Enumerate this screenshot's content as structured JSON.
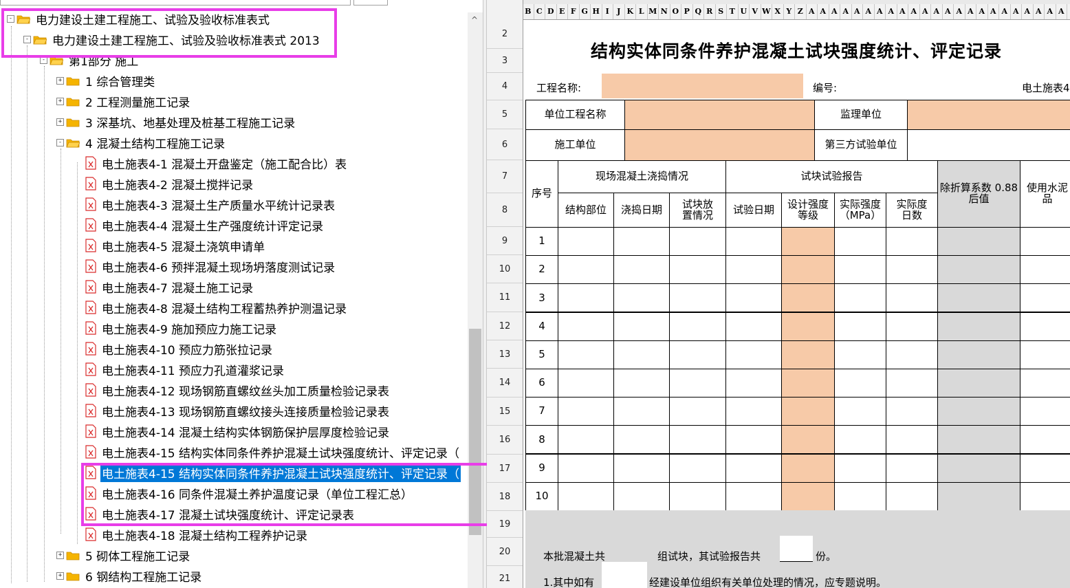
{
  "tree": {
    "root": "电力建设土建工程施工、试验及验收标准表式",
    "version": "电力建设土建工程施工、试验及验收标准表式 2013",
    "part": "第1部分 施工",
    "categories": [
      "1 综合管理类",
      "2 工程测量施工记录",
      "3 深基坑、地基处理及桩基工程施工记录",
      "4 混凝土结构工程施工记录"
    ],
    "items": [
      "电土施表4-1 混凝土开盘鉴定（施工配合比）表",
      "电土施表4-2 混凝土搅拌记录",
      "电土施表4-3 混凝土生产质量水平统计记录表",
      "电土施表4-4 混凝土生产强度统计评定记录",
      "电土施表4-5 混凝土浇筑申请单",
      "电土施表4-6 预拌混凝土现场坍落度测试记录",
      "电土施表4-7 混凝土施工记录",
      "电土施表4-8 混凝土结构工程蓄热养护测温记录",
      "电土施表4-9 施加预应力施工记录",
      "电土施表4-10 预应力筋张拉记录",
      "电土施表4-11 预应力孔道灌浆记录",
      "电土施表4-12 现场钢筋直螺纹丝头加工质量检验记录表",
      "电土施表4-13 现场钢筋直螺纹接头连接质量检验记录表",
      "电土施表4-14 混凝土结构实体钢筋保护层厚度检验记录",
      "电土施表4-15 结构实体同条件养护混凝土试块强度统计、评定记录（",
      "电土施表4-15 结构实体同条件养护混凝土试块强度统计、评定记录（",
      "电土施表4-16 同条件混凝土养护温度记录（单位工程汇总）",
      "电土施表4-17 混凝土试块强度统计、评定记录表",
      "电土施表4-18 混凝土结构工程养护记录"
    ],
    "more_categories": [
      "5 砌体工程施工记录",
      "6 钢结构工程施工记录"
    ],
    "selected_index": 15,
    "folder_color": "#f5b400",
    "doc_icon_color": "#d92b2b",
    "highlight_color": "#e83ee8",
    "selection_color": "#0078d7"
  },
  "sheet": {
    "columns": [
      "B",
      "C",
      "D",
      "E",
      "F",
      "G",
      "H",
      "I",
      "J",
      "K",
      "L",
      "M",
      "N",
      "O",
      "P",
      "Q",
      "R",
      "S",
      "T",
      "U",
      "V",
      "W",
      "X",
      "Y",
      "Z",
      "AA",
      "AB",
      "AC",
      "AD",
      "AE",
      "AF",
      "AG",
      "AH",
      "AI",
      "AJ",
      "AK",
      "AL",
      "AM",
      "AN",
      "AO",
      "AP",
      "AQ",
      "AR",
      "AS",
      "AT",
      "AU",
      "AV",
      "AW"
    ],
    "rows": [
      "2",
      "3",
      "4",
      "5",
      "6",
      "7",
      "8",
      "9",
      "10",
      "11",
      "12",
      "13",
      "14",
      "15",
      "16",
      "17",
      "18",
      "19",
      "20",
      "21"
    ],
    "form": {
      "title": "结构实体同条件养护混凝土试块强度统计、评定记录",
      "project_name_label": "工程名称:",
      "code_label": "编号:",
      "form_id": "电土施表4",
      "unit_project_label": "单位工程名称",
      "supervision_label": "监理单位",
      "construction_label": "施工单位",
      "third_party_label": "第三方试验单位",
      "seq_label": "序号",
      "site_group": "现场混凝土浇捣情况",
      "report_group": "试块试验报告",
      "struct_part": "结构部位",
      "pour_date": "浇捣日期",
      "placement": "试块放置情况",
      "test_date": "试验日期",
      "design_grade": "设计强度等级",
      "actual_strength": "实际强度（MPa）",
      "actual_age": "实际度日数",
      "conversion": "除折算系数 0.88后值",
      "cement": "使用水泥品",
      "seq_numbers": [
        "1",
        "2",
        "3",
        "4",
        "5",
        "6",
        "7",
        "8",
        "9",
        "10"
      ],
      "footer_1a": "本批混凝土共",
      "footer_1b": "组试块，其试验报告共",
      "footer_1c": "份。",
      "footer_2a": "1.其中如有",
      "footer_2b": "经建设单位组织有关单位处理的情况，应专题说明。"
    },
    "peach_color": "#f7caa8",
    "gray_color": "#d9d9d9"
  }
}
